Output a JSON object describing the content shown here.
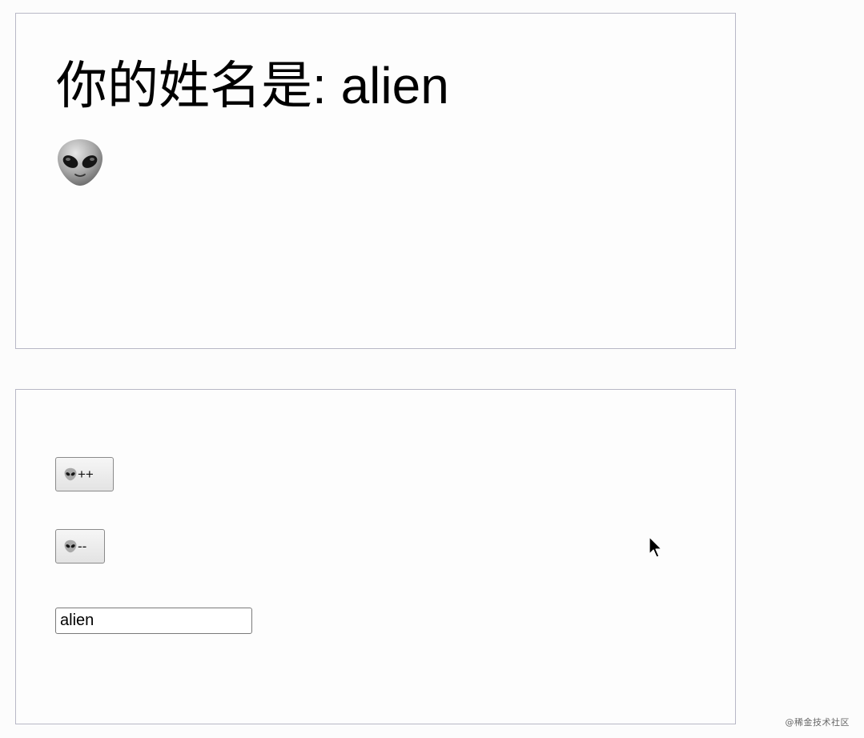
{
  "display": {
    "label": "你的姓名是: ",
    "name_value": "alien",
    "emoji": "alien-face-icon"
  },
  "controls": {
    "increment_label": "++",
    "decrement_label": "--",
    "button_icon": "alien-face-icon",
    "name_input_value": "alien"
  },
  "watermark": "@稀金技术社区"
}
